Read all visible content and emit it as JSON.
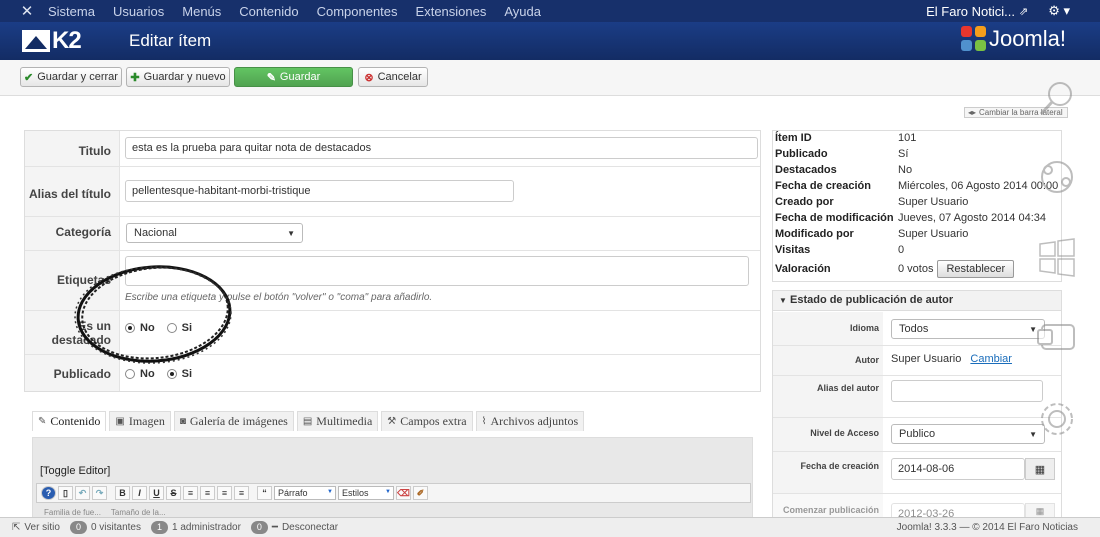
{
  "topnav": {
    "menu": [
      "Sistema",
      "Usuarios",
      "Menús",
      "Contenido",
      "Componentes",
      "Extensiones",
      "Ayuda"
    ],
    "site_name": "El Faro Notici...",
    "gear": "⚙ ▾"
  },
  "header": {
    "logo_text": "K2",
    "title": "Editar ítem",
    "brand": "Joomla!"
  },
  "toolbar": {
    "save_close": "Guardar y cerrar",
    "save_new": "Guardar y nuevo",
    "save": "Guardar",
    "cancel": "Cancelar"
  },
  "sidebar_toggle": "Cambiar la barra lateral",
  "form": {
    "title_label": "Titulo",
    "title_value": "esta es la prueba para quitar nota de destacados",
    "alias_label": "Alias del título",
    "alias_value": "pellentesque-habitant-morbi-tristique",
    "category_label": "Categoría",
    "category_value": "Nacional",
    "tags_label": "Etiquetas",
    "tags_hint": "Escribe una etiqueta y pulse el botón \"volver\" o \"coma\" para añadirlo.",
    "featured_label": "¿Es un destacado?",
    "featured_label_visible_1": "Es un",
    "featured_label_visible_2": "destacado",
    "no": "No",
    "yes": "Si",
    "published_label": "Publicado"
  },
  "tabs": [
    {
      "label": "Contenido",
      "icon": "edit-icon"
    },
    {
      "label": "Imagen",
      "icon": "image-icon"
    },
    {
      "label": "Galería de imágenes",
      "icon": "camera-icon"
    },
    {
      "label": "Multimedia",
      "icon": "film-icon"
    },
    {
      "label": "Campos extra",
      "icon": "wrench-icon"
    },
    {
      "label": "Archivos adjuntos",
      "icon": "paperclip-icon"
    }
  ],
  "editor": {
    "toggle": "[Toggle Editor]",
    "format_select": "Párrafo",
    "styles_select": "Estilos",
    "font_family": "Familia de fue...",
    "font_size": "Tamaño de la..."
  },
  "info": [
    {
      "k": "Ítem ID",
      "v": "101"
    },
    {
      "k": "Publicado",
      "v": "Sí"
    },
    {
      "k": "Destacados",
      "v": "No"
    },
    {
      "k": "Fecha de creación",
      "v": "Miércoles, 06 Agosto 2014 00:00"
    },
    {
      "k": "Creado por",
      "v": "Super Usuario"
    },
    {
      "k": "Fecha de modificación",
      "v": "Jueves, 07 Agosto 2014 04:34"
    },
    {
      "k": "Modificado por",
      "v": "Super Usuario"
    },
    {
      "k": "Visitas",
      "v": "0"
    },
    {
      "k": "Valoración",
      "v": "0 votos"
    }
  ],
  "reset_label": "Restablecer",
  "publishing": {
    "heading": "Estado de publicación de autor",
    "language_label": "Idioma",
    "language_value": "Todos",
    "author_label": "Autor",
    "author_value": "Super Usuario",
    "author_change": "Cambiar",
    "author_alias_label": "Alias del autor",
    "access_label": "Nivel de Acceso",
    "access_value": "Publico",
    "created_label": "Fecha de creación",
    "created_value": "2014-08-06",
    "start_label": "Comenzar publicación",
    "start_value": "2012-03-26"
  },
  "status": {
    "view_site": "Ver sitio",
    "visitors_count": "0",
    "visitors": "0 visitantes",
    "admins_count": "1",
    "admins": "1 administrador",
    "logout_count": "0",
    "logout": "Desconectar",
    "footer": "Joomla! 3.3.3 — © 2014 El Faro Noticias"
  }
}
